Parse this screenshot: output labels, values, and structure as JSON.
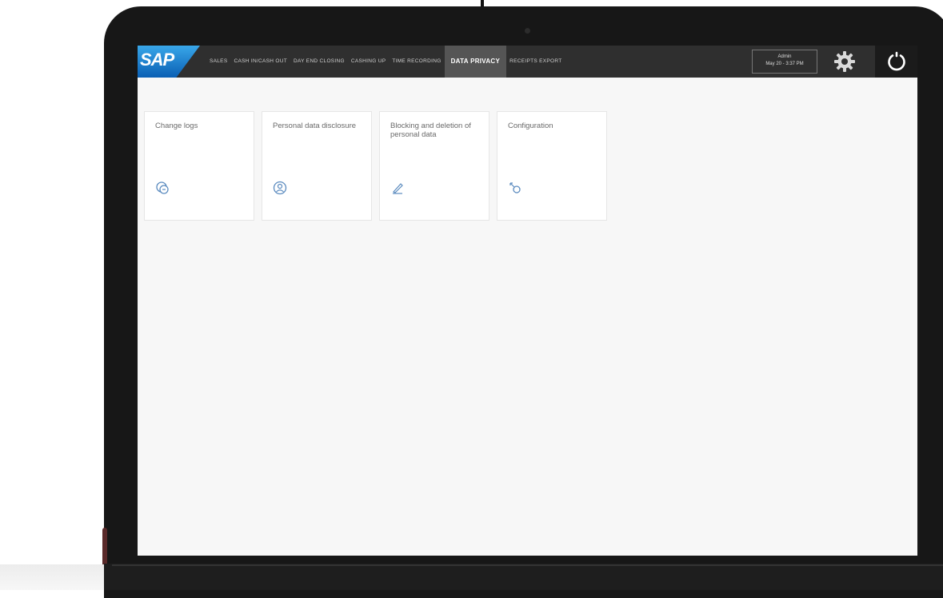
{
  "header": {
    "logo": "SAP",
    "nav": [
      "SALES",
      "CASH IN/CASH OUT",
      "DAY END CLOSING",
      "CASHING UP",
      "TIME RECORDING",
      "DATA PRIVACY",
      "RECEIPTS EXPORT"
    ],
    "active_nav": "DATA PRIVACY",
    "user": "Admin",
    "datetime": "May 20 - 3:37 PM"
  },
  "tiles": [
    {
      "title": "Change logs",
      "icon": "change-log-icon"
    },
    {
      "title": "Personal data disclosure",
      "icon": "person-icon"
    },
    {
      "title": "Blocking and deletion of personal data",
      "icon": "eraser-icon"
    },
    {
      "title": "Configuration",
      "icon": "key-icon"
    }
  ],
  "colors": {
    "topbar": "#2f2f2f",
    "active_tab": "#555555",
    "sap_blue": "#1a7bd0",
    "icon": "#5b8bbf"
  }
}
